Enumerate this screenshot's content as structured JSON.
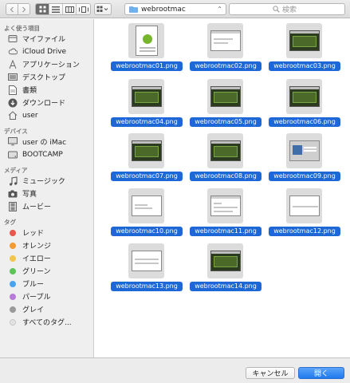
{
  "toolbar": {
    "path_label": "webrootmac",
    "search_placeholder": "検索",
    "icons": {
      "back": "chevron-left-icon",
      "forward": "chevron-right-icon",
      "view_icon": "icon-view-icon",
      "view_list": "list-view-icon",
      "view_column": "column-view-icon",
      "view_cover": "coverflow-view-icon",
      "arrange": "arrange-grid-icon",
      "search": "search-icon"
    }
  },
  "sidebar": {
    "favorites_heading": "よく使う項目",
    "favorites": [
      {
        "label": "マイファイル",
        "icon": "all-files-icon"
      },
      {
        "label": "iCloud Drive",
        "icon": "cloud-icon"
      },
      {
        "label": "アプリケーション",
        "icon": "applications-icon"
      },
      {
        "label": "デスクトップ",
        "icon": "desktop-icon"
      },
      {
        "label": "書類",
        "icon": "document-icon"
      },
      {
        "label": "ダウンロード",
        "icon": "download-icon"
      },
      {
        "label": "user",
        "icon": "home-icon"
      }
    ],
    "devices_heading": "デバイス",
    "devices": [
      {
        "label": "user の iMac",
        "icon": "imac-icon"
      },
      {
        "label": "BOOTCAMP",
        "icon": "disk-icon"
      }
    ],
    "media_heading": "メディア",
    "media": [
      {
        "label": "ミュージック",
        "icon": "music-icon"
      },
      {
        "label": "写真",
        "icon": "camera-icon"
      },
      {
        "label": "ムービー",
        "icon": "film-icon"
      }
    ],
    "tags_heading": "タグ",
    "tags": [
      {
        "label": "レッド",
        "color": "#e8564c"
      },
      {
        "label": "オレンジ",
        "color": "#f39a33"
      },
      {
        "label": "イエロー",
        "color": "#f2c54b"
      },
      {
        "label": "グリーン",
        "color": "#5ec357"
      },
      {
        "label": "ブルー",
        "color": "#4aa3ee"
      },
      {
        "label": "パープル",
        "color": "#b87ad8"
      },
      {
        "label": "グレイ",
        "color": "#9a9a9a"
      },
      {
        "label": "すべてのタグ...",
        "color": "#e2e2e2"
      }
    ]
  },
  "files": [
    {
      "name": "webrootmac01.png",
      "thumb": "tall"
    },
    {
      "name": "webrootmac02.png",
      "thumb": "light"
    },
    {
      "name": "webrootmac03.png",
      "thumb": "dark"
    },
    {
      "name": "webrootmac04.png",
      "thumb": "dark"
    },
    {
      "name": "webrootmac05.png",
      "thumb": "dark"
    },
    {
      "name": "webrootmac06.png",
      "thumb": "dark"
    },
    {
      "name": "webrootmac07.png",
      "thumb": "dark"
    },
    {
      "name": "webrootmac08.png",
      "thumb": "dark"
    },
    {
      "name": "webrootmac09.png",
      "thumb": "gray"
    },
    {
      "name": "webrootmac10.png",
      "thumb": "light"
    },
    {
      "name": "webrootmac11.png",
      "thumb": "light"
    },
    {
      "name": "webrootmac12.png",
      "thumb": "light"
    },
    {
      "name": "webrootmac13.png",
      "thumb": "light"
    },
    {
      "name": "webrootmac14.png",
      "thumb": "dark"
    }
  ],
  "buttons": {
    "cancel": "キャンセル",
    "open": "開く"
  },
  "colors": {
    "selection": "#1d67d6",
    "primary_button": "#1f79ef"
  }
}
